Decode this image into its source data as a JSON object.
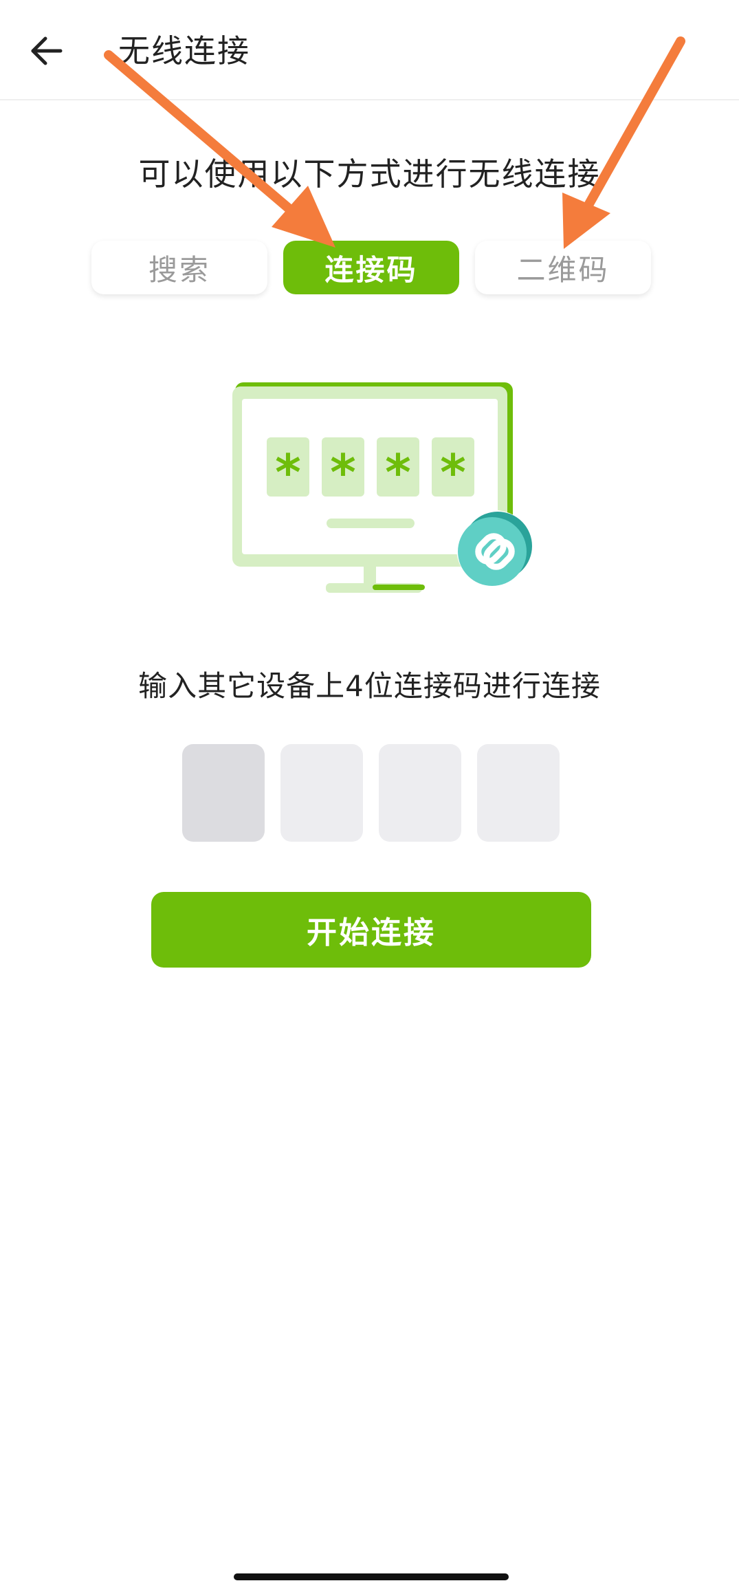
{
  "header": {
    "title": "无线连接",
    "back_icon": "arrow-left-icon"
  },
  "instruction": "可以使用以下方式进行无线连接",
  "tabs": [
    {
      "label": "搜索",
      "active": false
    },
    {
      "label": "连接码",
      "active": true
    },
    {
      "label": "二维码",
      "active": false
    }
  ],
  "illustration": {
    "masked_digits": [
      "*",
      "*",
      "*",
      "*"
    ],
    "icons": [
      "monitor-icon",
      "link-icon"
    ]
  },
  "code_hint": "输入其它设备上4位连接码进行连接",
  "code_inputs": [
    "",
    "",
    "",
    ""
  ],
  "connect_button": "开始连接",
  "colors": {
    "accent": "#6ebd0a",
    "link_badge": "#4fc7bd",
    "annotation_arrow": "#f47c3c"
  }
}
